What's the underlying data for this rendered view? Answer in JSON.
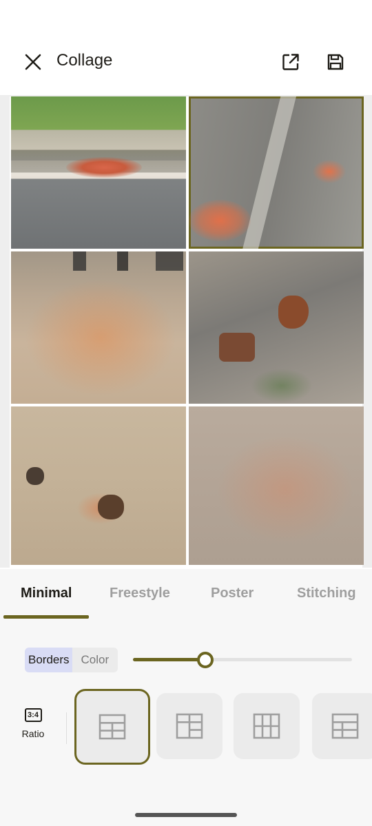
{
  "appbar": {
    "title": "Collage",
    "close_icon": "close-icon",
    "share_icon": "open-in-new-icon",
    "save_icon": "save-icon"
  },
  "collage": {
    "tiles": [
      {
        "name": "photo-road-curb-bricks",
        "selected": false
      },
      {
        "name": "photo-road-orange-dust",
        "selected": true
      },
      {
        "name": "photo-dirt-road-people",
        "selected": false
      },
      {
        "name": "photo-rocks-gravel",
        "selected": false
      },
      {
        "name": "photo-ground-stones",
        "selected": false
      },
      {
        "name": "photo-dusty-road",
        "selected": false
      }
    ]
  },
  "tabs": [
    {
      "label": "Minimal",
      "active": true
    },
    {
      "label": "Freestyle",
      "active": false
    },
    {
      "label": "Poster",
      "active": false
    },
    {
      "label": "Stitching",
      "active": false
    }
  ],
  "border_controls": {
    "borders_label": "Borders",
    "color_label": "Color",
    "selected": "Borders",
    "slider_value": 0.33
  },
  "ratio": {
    "icon_text": "3:4",
    "label": "Ratio"
  },
  "layouts": [
    {
      "name": "grid-2x3",
      "selected": true
    },
    {
      "name": "grid-2x3-alt",
      "selected": false
    },
    {
      "name": "grid-3x3",
      "selected": false
    },
    {
      "name": "grid-2x3-wide",
      "selected": false
    }
  ],
  "colors": {
    "accent": "#6b6520",
    "segment_selected_bg": "#d9dcf5",
    "panel_bg": "#f7f7f7"
  }
}
